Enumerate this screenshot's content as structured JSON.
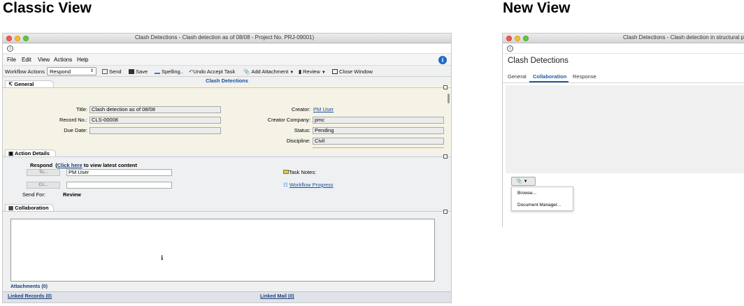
{
  "headings": {
    "classic": "Classic View",
    "new": "New View"
  },
  "classic": {
    "window_title": "Clash Detections - Clash detection as of 08/08 - Project No. PRJ-09001)",
    "info_icon": "i",
    "menu": [
      "File",
      "Edit",
      "View",
      "Actions",
      "Help"
    ],
    "help_icon": "i",
    "toolbar": {
      "workflow_label": "Workflow Actions",
      "workflow_value": "Respond",
      "send": "Send",
      "save": "Save",
      "spelling": "Spelling..",
      "undo": "Undo Accept Task",
      "add_attachment": "Add Attachment",
      "review": "Review",
      "close": "Close Window"
    },
    "form_title": "Clash Detections",
    "general": {
      "tab": "General",
      "title_label": "Title:",
      "title_value": "Clash detection as of 08/08",
      "record_label": "Record No.:",
      "record_value": "CLS-00008",
      "due_label": "Due Date:",
      "due_value": "",
      "creator_label": "Creator:",
      "creator_value": "PM User",
      "company_label": "Creator Company:",
      "company_value": "pmc",
      "status_label": "Status:",
      "status_value": "Pending",
      "discipline_label": "Discipline:",
      "discipline_value": "Civil"
    },
    "action": {
      "tab": "Action Details",
      "respond": "Respond",
      "paren_open": "(",
      "click_here": "Click here",
      "view_latest": " to view latest content",
      "to_btn": "To...",
      "to_value": "PM User",
      "cc_btn": "Cc...",
      "cc_value": "",
      "send_for_label": "Send For:",
      "send_for_value": "Review",
      "task_notes": "Task Notes:",
      "workflow_progress": "Workflow Progress"
    },
    "collab": {
      "tab": "Collaboration",
      "attachments": "Attachments (0)",
      "linked_records": "Linked Records (0)",
      "linked_mail": "Linked Mail (0)"
    }
  },
  "newview": {
    "window_title": "Clash Detections - Clash detection in structural pa",
    "info_icon": "i",
    "title": "Clash Detections",
    "tabs": [
      "General",
      "Collaboration",
      "Response"
    ],
    "active_tab": "Collaboration",
    "menu_items": [
      "Browse...",
      "Document Manager..."
    ]
  }
}
